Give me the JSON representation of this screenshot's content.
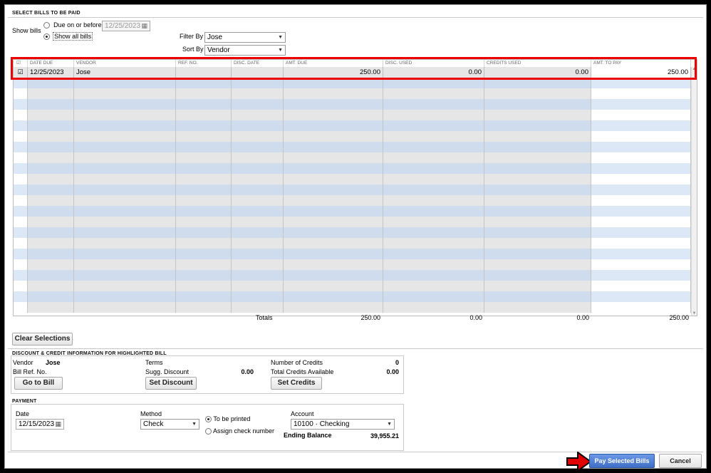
{
  "header": {
    "title": "SELECT BILLS TO BE PAID"
  },
  "show_bills": {
    "label": "Show bills",
    "option_due": "Due on or before",
    "due_date": "12/25/2023",
    "option_all": "Show all bills",
    "selected": "all"
  },
  "filter": {
    "filter_label": "Filter By",
    "filter_value": "Jose",
    "sort_label": "Sort By",
    "sort_value": "Vendor"
  },
  "grid": {
    "columns": [
      "DATE DUE",
      "VENDOR",
      "REF. NO.",
      "DISC. DATE",
      "AMT. DUE",
      "DISC. USED",
      "CREDITS USED",
      "AMT. TO PAY"
    ],
    "rows": [
      {
        "checked": true,
        "date_due": "12/25/2023",
        "vendor": "Jose",
        "ref_no": "",
        "disc_date": "",
        "amt_due": "250.00",
        "disc_used": "0.00",
        "credits_used": "0.00",
        "amt_to_pay": "250.00"
      }
    ]
  },
  "totals": {
    "label": "Totals",
    "amt_due": "250.00",
    "disc_used": "0.00",
    "credits_used": "0.00",
    "amt_to_pay": "250.00"
  },
  "buttons": {
    "clear": "Clear Selections",
    "go_to_bill": "Go to Bill",
    "set_discount": "Set Discount",
    "set_credits": "Set Credits",
    "pay": "Pay Selected Bills",
    "cancel": "Cancel"
  },
  "discount": {
    "title": "DISCOUNT & CREDIT INFORMATION FOR HIGHLIGHTED BILL",
    "vendor_label": "Vendor",
    "vendor_value": "Jose",
    "bill_ref_label": "Bill Ref. No.",
    "terms_label": "Terms",
    "sugg_label": "Sugg. Discount",
    "sugg_value": "0.00",
    "num_credits_label": "Number of Credits",
    "num_credits_value": "0",
    "total_credits_label": "Total Credits Available",
    "total_credits_value": "0.00"
  },
  "payment": {
    "title": "PAYMENT",
    "date_label": "Date",
    "date_value": "12/15/2023",
    "method_label": "Method",
    "method_value": "Check",
    "to_be_printed": "To be printed",
    "assign_number": "Assign check number",
    "account_label": "Account",
    "account_value": "10100 · Checking",
    "ending_label": "Ending Balance",
    "ending_value": "39,955.21"
  },
  "colors": {
    "highlight": "#e00000",
    "pay_button": "#4a7ad0",
    "stripe": "#dce8f5"
  }
}
